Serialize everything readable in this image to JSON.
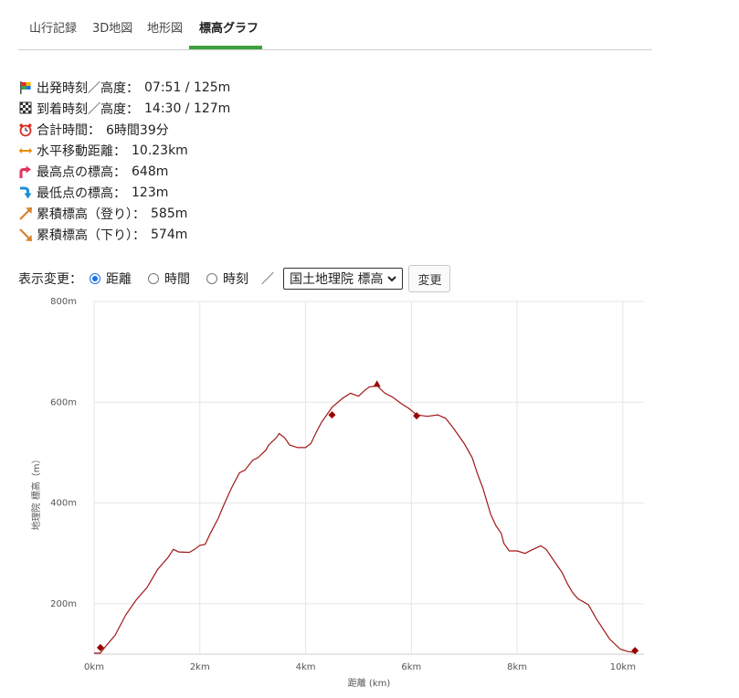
{
  "tabs": [
    {
      "label": "山行記録"
    },
    {
      "label": "3D地図"
    },
    {
      "label": "地形図"
    },
    {
      "label": "標高グラフ"
    }
  ],
  "stats": [
    {
      "label": "出発時刻／高度：",
      "value": "07:51 / 125m",
      "icon": "start-flag-icon"
    },
    {
      "label": "到着時刻／高度：",
      "value": "14:30 / 127m",
      "icon": "finish-flag-icon"
    },
    {
      "label": "合計時間：",
      "value": "6時間39分",
      "icon": "alarm-clock-icon"
    },
    {
      "label": "水平移動距離：",
      "value": "10.23km",
      "icon": "horizontal-arrow-icon"
    },
    {
      "label": "最高点の標高：",
      "value": "648m",
      "icon": "arrow-up-icon"
    },
    {
      "label": "最低点の標高：",
      "value": "123m",
      "icon": "arrow-down-icon"
    },
    {
      "label": "累積標高（登り）：",
      "value": "585m",
      "icon": "ascent-arrow-icon"
    },
    {
      "label": "累積標高（下り）：",
      "value": "574m",
      "icon": "descent-arrow-icon"
    }
  ],
  "controls": {
    "label": "表示変更：",
    "options": [
      {
        "label": "距離",
        "checked": true
      },
      {
        "label": "時間",
        "checked": false
      },
      {
        "label": "時刻",
        "checked": false
      }
    ],
    "separator": "／",
    "select_value": "国土地理院 標高",
    "button_label": "変更"
  },
  "chart_data": {
    "type": "line",
    "xlabel": "距離 (km)",
    "ylabel": "地理院 標高（m）",
    "xlim": [
      0,
      10.4
    ],
    "ylim": [
      100,
      800
    ],
    "x_ticks": [
      0,
      2,
      4,
      6,
      8,
      10
    ],
    "x_tick_labels": [
      "0km",
      "2km",
      "4km",
      "6km",
      "8km",
      "10km"
    ],
    "y_ticks": [
      200,
      400,
      600,
      800
    ],
    "y_tick_labels": [
      "200m",
      "400m",
      "600m",
      "800m"
    ],
    "grid": true,
    "line_color": "#a01818",
    "x": [
      0.0,
      0.12,
      0.2,
      0.4,
      0.6,
      0.8,
      1.0,
      1.2,
      1.4,
      1.45,
      1.5,
      1.6,
      1.8,
      1.9,
      2.0,
      2.1,
      2.2,
      2.35,
      2.45,
      2.6,
      2.75,
      2.85,
      3.0,
      3.1,
      3.25,
      3.3,
      3.45,
      3.5,
      3.6,
      3.7,
      3.85,
      4.0,
      4.1,
      4.2,
      4.3,
      4.4,
      4.5,
      4.7,
      4.85,
      5.0,
      5.1,
      5.2,
      5.35,
      5.5,
      5.65,
      5.8,
      5.95,
      6.1,
      6.3,
      6.5,
      6.65,
      6.8,
      7.0,
      7.15,
      7.25,
      7.35,
      7.5,
      7.6,
      7.7,
      7.75,
      7.85,
      8.0,
      8.15,
      8.3,
      8.45,
      8.55,
      8.7,
      8.85,
      8.95,
      9.05,
      9.15,
      9.35,
      9.5,
      9.75,
      9.95,
      10.1,
      10.23
    ],
    "values": [
      102,
      102,
      113,
      138,
      178,
      208,
      232,
      268,
      292,
      300,
      308,
      303,
      302,
      308,
      316,
      318,
      340,
      370,
      395,
      430,
      460,
      465,
      485,
      490,
      505,
      515,
      530,
      538,
      530,
      515,
      510,
      510,
      518,
      540,
      560,
      575,
      590,
      608,
      618,
      612,
      622,
      630,
      633,
      618,
      610,
      598,
      588,
      575,
      572,
      575,
      568,
      548,
      518,
      490,
      458,
      430,
      378,
      355,
      340,
      320,
      305,
      305,
      300,
      308,
      315,
      308,
      285,
      262,
      240,
      222,
      210,
      198,
      170,
      130,
      110,
      105,
      103
    ],
    "markers": [
      {
        "x": 0.12,
        "y": 113,
        "shape": "diamond"
      },
      {
        "x": 4.5,
        "y": 575,
        "shape": "diamond"
      },
      {
        "x": 5.35,
        "y": 636,
        "shape": "triangle"
      },
      {
        "x": 6.1,
        "y": 573,
        "shape": "diamond"
      },
      {
        "x": 10.23,
        "y": 107,
        "shape": "diamond"
      }
    ]
  }
}
